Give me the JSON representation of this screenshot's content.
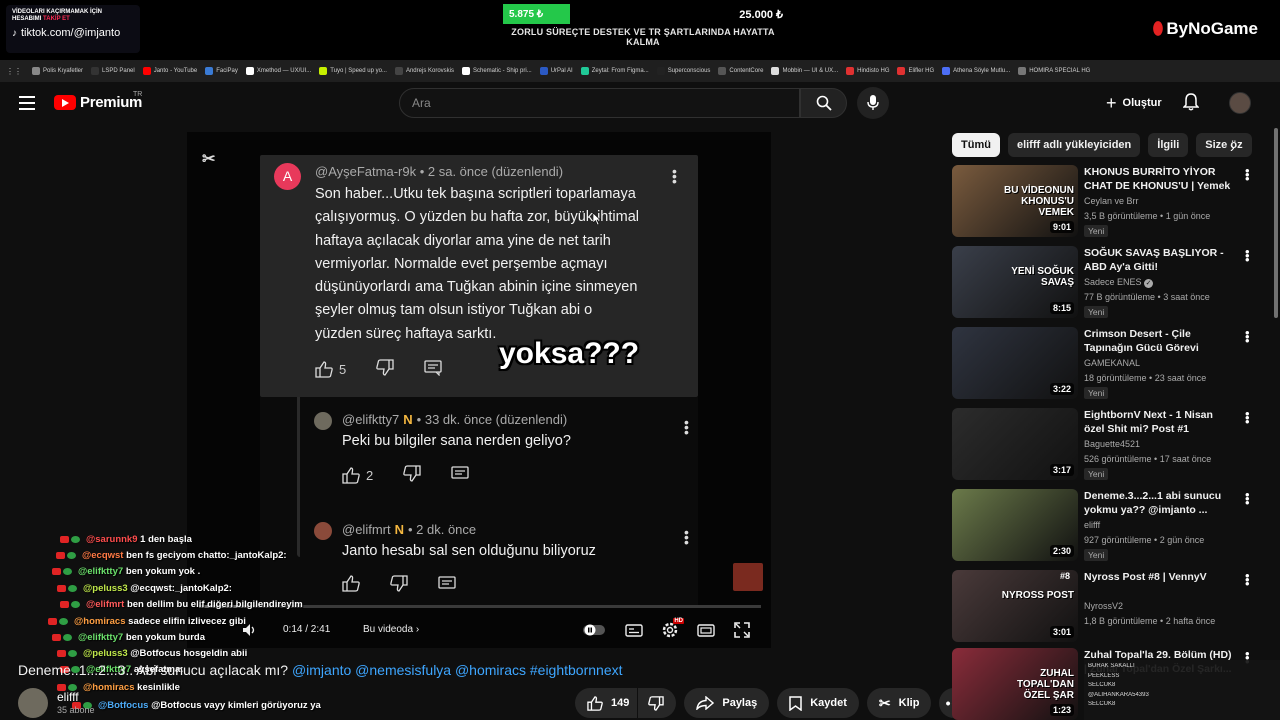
{
  "stream": {
    "tiktok_line1": "VİDEOLARI KAÇIRMAMAK İÇİN",
    "tiktok_line2a": "HESABIMI ",
    "tiktok_line2b": "TAKİP ET",
    "tiktok_handle": "tiktok.com/@imjanto",
    "goal_current": "5.875 ₺",
    "goal_target": "25.000 ₺",
    "goal_progress": 0.235,
    "goal_text": "ZORLU SÜREÇTE DESTEK VE TR ŞARTLARINDA HAYATTA KALMA",
    "sponsor": "ByNoGame"
  },
  "bookmarks": [
    {
      "label": "Polis Kıyafetler",
      "color": "#888888"
    },
    {
      "label": "LSPD Panel",
      "color": "#333333"
    },
    {
      "label": "Janto - YouTube",
      "color": "#ff0000"
    },
    {
      "label": "FaciPay",
      "color": "#3a7bd5"
    },
    {
      "label": "Xmethod — UX/UI...",
      "color": "#ffffff"
    },
    {
      "label": "Tuyo | Speed up yo...",
      "color": "#c7f000"
    },
    {
      "label": "Andrejs Korovskis",
      "color": "#444444"
    },
    {
      "label": "Schematic - Ship pri...",
      "color": "#ffffff"
    },
    {
      "label": "UrPal AI",
      "color": "#2b59c3"
    },
    {
      "label": "Zeytal: From Figma...",
      "color": "#20c997"
    },
    {
      "label": "Superconscious",
      "color": "#222222"
    },
    {
      "label": "ContentCore",
      "color": "#555555"
    },
    {
      "label": "Mobbin — UI & UX...",
      "color": "#dddddd"
    },
    {
      "label": "Hindisto HG",
      "color": "#e03131"
    },
    {
      "label": "Elifler HG",
      "color": "#e03131"
    },
    {
      "label": "Athena Söyle Mutlu...",
      "color": "#4c6ef5"
    },
    {
      "label": "HOMIRA SPECIAL HG",
      "color": "#777777"
    }
  ],
  "header": {
    "brand": "Premium",
    "country": "TR",
    "search_placeholder": "Ara",
    "create_label": "Oluştur"
  },
  "video": {
    "comment": {
      "avatar_letter": "A",
      "author": "@AyşeFatma-r9k",
      "meta": "• 2 sa. önce (düzenlendi)",
      "lines": [
        "Son haber...Utku tek başına scriptleri toparlamaya",
        "çalışıyormuş. O yüzden bu hafta zor, büyük ihtimal",
        "haftaya açılacak diyorlar ama yine de net tarih",
        "vermiyorlar. Normalde evet perşembe açmayı",
        "düşünüyorlardı ama Tuğkan abinin içine sinmeyen",
        "şeyler olmuş tam olsun istiyor Tuğkan abi o",
        "yüzden süreç haftaya sarktı."
      ],
      "likes": "5"
    },
    "reply1": {
      "author": "@elifktty7",
      "meta": "• 33 dk. önce (düzenlendi)",
      "text": "Peki bu bilgiler sana nerden geliyo?",
      "likes": "2"
    },
    "reply2": {
      "author": "@elifmrt",
      "meta": "• 2 dk. önce",
      "text": "Janto hesabı sal sen olduğunu biliyoruz"
    },
    "caption_overlay": "yoksa???",
    "time": "0:14 / 2:41",
    "progress": 0.087,
    "in_video": "Bu videoda",
    "hd_badge": "HD"
  },
  "chat": [
    {
      "user": "@sarunnk9",
      "color": "#ff4d4d",
      "text": "1 den başla"
    },
    {
      "user": "@ecqwst",
      "color": "#ff7a45",
      "text": "ben fs geciyom chatto:_jantoKalp2:"
    },
    {
      "user": "@elifktty7",
      "color": "#6be06b",
      "text": "ben yokum yok ."
    },
    {
      "user": "@peluss3",
      "color": "#c0e84b",
      "text": "@ecqwst:_jantoKalp2:"
    },
    {
      "user": "@elifmrt",
      "color": "#ff5a5a",
      "text": "ben dellim bu elif diğeri bilgilendireyim"
    },
    {
      "user": "@homiracs",
      "color": "#ff9f43",
      "text": "sadece elifin izlivecez gibi"
    },
    {
      "user": "@elifktty7",
      "color": "#6be06b",
      "text": "ben yokum burda"
    },
    {
      "user": "@peluss3",
      "color": "#c0e84b",
      "text": "@Botfocus hosgeldin abii"
    },
    {
      "user": "@elifktty7",
      "color": "#6be06b",
      "text": "ayşefatma:"
    },
    {
      "user": "@homiracs",
      "color": "#ff9f43",
      "text": "kesinlikle"
    },
    {
      "user": "@Botfocus",
      "color": "#4dabf7",
      "text": "@Botfocus vayy kimleri görüyoruz ya"
    }
  ],
  "title": {
    "text": "Deneme..1...2...3.. Abi sunucu açılacak mı? ",
    "tags": "@imjanto @nemesisfulya @homiracs #eightbornnext"
  },
  "channel": {
    "name": "elifff",
    "subs": "35 abone"
  },
  "actions": {
    "likes": "149",
    "share": "Paylaş",
    "save": "Kaydet",
    "clip": "Klip"
  },
  "chips": [
    "Tümü",
    "elifff adlı yükleyiciden",
    "İlgili",
    "Size öz"
  ],
  "recommendations": [
    {
      "title": "KHONUS BURRİTO YİYOR CHAT DE KHONUS'U | Yemek Yayını",
      "channel": "Ceylan ve Brr",
      "meta": "3,5 B görüntüleme • 1 gün önce",
      "badge": "Yeni",
      "duration": "9:01",
      "thumb_text": "BU VİDEONUN KHONUS'U VEMEK",
      "bg": "#7a5b3e",
      "verified": false
    },
    {
      "title": "SOĞUK SAVAŞ BAŞLIYOR - ABD Ay'a Gitti!",
      "channel": "Sadece ENES",
      "meta": "77 B görüntüleme • 3 saat önce",
      "badge": "Yeni",
      "duration": "8:15",
      "thumb_text": "YENİ SOĞUK SAVAŞ",
      "bg": "#3a3f4a",
      "verified": true
    },
    {
      "title": "Crimson Desert - Çile Tapınağın Gücü Görevi",
      "channel": "GAMEKANAL",
      "meta": "18 görüntüleme • 23 saat önce",
      "badge": "Yeni",
      "duration": "3:22",
      "thumb_text": "",
      "bg": "#2f3440",
      "verified": false
    },
    {
      "title": "EightbornV Next - 1 Nisan özel Shit mi? Post #1",
      "channel": "Baguette4521",
      "meta": "526 görüntüleme • 17 saat önce",
      "badge": "Yeni",
      "duration": "3:17",
      "thumb_text": "",
      "bg": "#2c2c2c",
      "verified": false
    },
    {
      "title": "Deneme.3...2...1 abi sunucu yokmu ya?? @imjanto ...",
      "channel": "elifff",
      "meta": "927 görüntüleme • 2 gün önce",
      "badge": "Yeni",
      "duration": "2:30",
      "thumb_text": "",
      "bg": "#6b7a4a",
      "verified": false
    },
    {
      "title": "Nyross Post #8 | VennyV",
      "channel": "NyrossV2",
      "meta": "1,8 B görüntüleme • 2 hafta önce",
      "badge": "",
      "duration": "3:01",
      "thumb_text": "NYROSS POST",
      "bg": "#4a3a3a",
      "verified": false
    },
    {
      "title": "Zuhal Topal'la 29. Bölüm (HD) | Zuhal Topal'dan Özel Şarkı...",
      "channel": "",
      "meta": "",
      "badge": "",
      "duration": "1:23",
      "thumb_text": "ZUHAL TOPAL'DAN ÖZEL ŞAR",
      "bg": "#8a2c3a",
      "verified": false
    }
  ],
  "rec8_badge": "#8",
  "overlay_list": [
    "BURAK SAKALLI",
    "PEEKLESS",
    "SELCUK8",
    "@ALİHANKARA54393",
    "SELCUK8"
  ]
}
